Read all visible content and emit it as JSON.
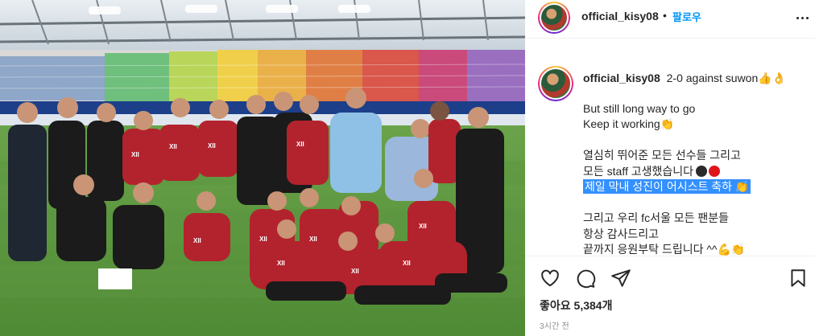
{
  "post": {
    "image_alt": "FC Seoul team photo celebrating on the pitch",
    "sponsor_on_shirt": "GS 칼텍스"
  },
  "header": {
    "username": "official_kisy08",
    "separator": "•",
    "follow_label": "팔로우",
    "more_icon": "more-horizontal-icon"
  },
  "caption": {
    "username": "official_kisy08",
    "first_line": "2-0 against suwon",
    "first_line_emoji": "👍👌",
    "lines": [
      {
        "text": "But still long way to go",
        "emoji": ""
      },
      {
        "text": "Keep it working",
        "emoji": "👏"
      },
      {
        "text": "",
        "emoji": ""
      },
      {
        "text": "열심히 뛰어준 모든 선수들 그리고",
        "emoji": ""
      },
      {
        "text": "모든 staff 고생했습니다",
        "emoji": "⚫🔴"
      },
      {
        "text": "제일 막내 성진이 어시스트 축하",
        "emoji": "👏",
        "highlighted": true
      },
      {
        "text": "",
        "emoji": ""
      },
      {
        "text": "그리고 우리 fc서울 모든 팬분들",
        "emoji": ""
      },
      {
        "text": "항상 감사드리고",
        "emoji": ""
      },
      {
        "text": "끝까지 응원부탁 드립니다 ^^",
        "emoji": "💪👏"
      }
    ]
  },
  "actions": {
    "like_icon": "heart-icon",
    "comment_icon": "comment-icon",
    "share_icon": "send-icon",
    "save_icon": "bookmark-icon"
  },
  "likes": {
    "label": "좋아요",
    "count": "5,384개"
  },
  "timestamp": "3시간 전",
  "colors": {
    "follow_blue": "#0095f6",
    "highlight": "#3390ff",
    "shirt_red": "#b3232d",
    "pitch_green": "#5f9a3f"
  }
}
